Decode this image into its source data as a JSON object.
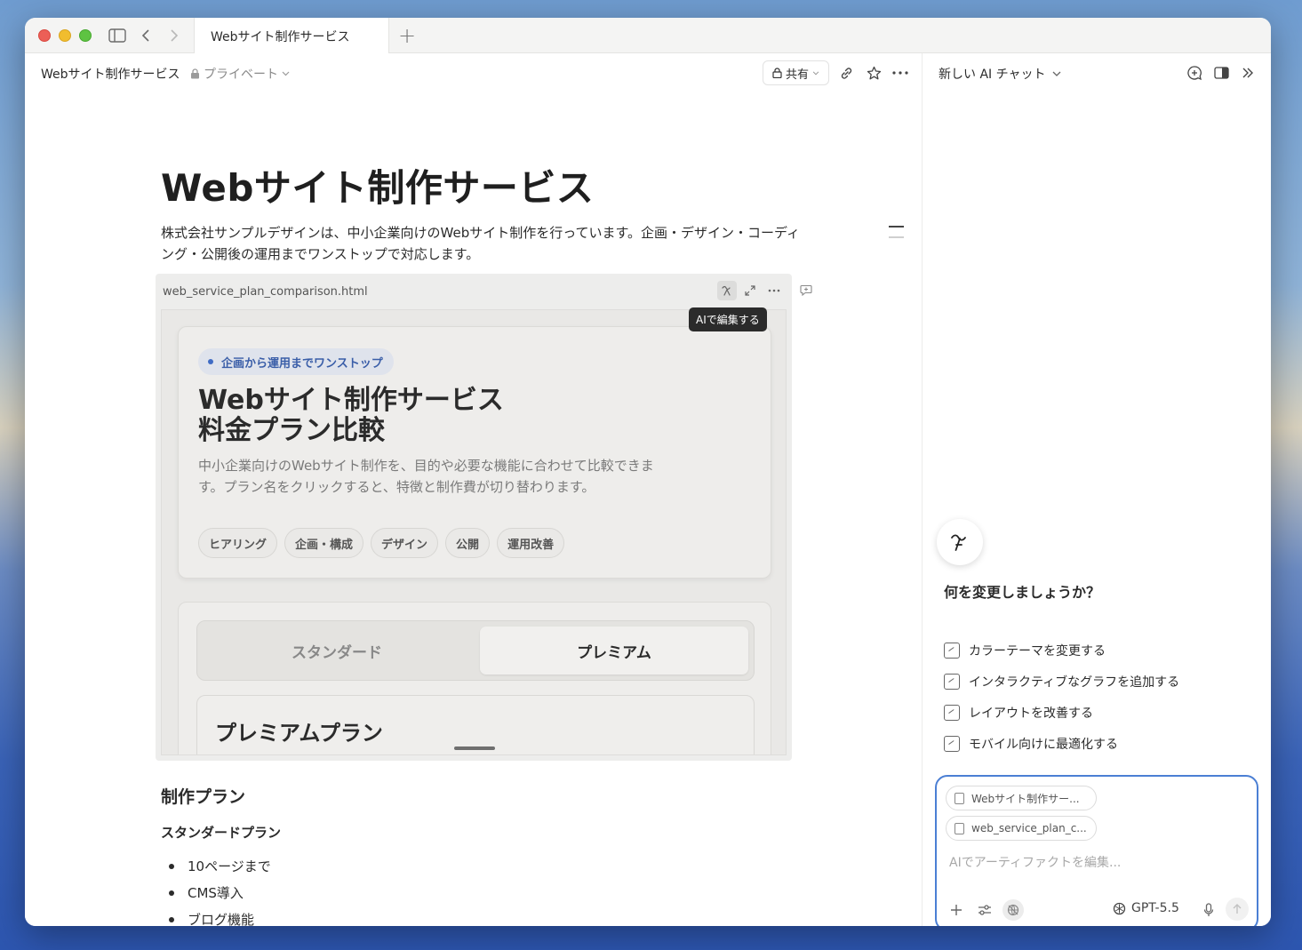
{
  "tab": {
    "title": "Webサイト制作サービス"
  },
  "doc_header": {
    "breadcrumb": "Webサイト制作サービス",
    "privacy": "プライベート",
    "share": "共有"
  },
  "document": {
    "title": "Webサイト制作サービス",
    "intro": "株式会社サンプルデザインは、中小企業向けのWebサイト制作を行っています。企画・デザイン・コーディング・公開後の運用までワンストップで対応します。",
    "artifact": {
      "filename": "web_service_plan_comparison.html",
      "tooltip": "AIで編集する",
      "preview": {
        "badge": "企画から運用までワンストップ",
        "title_line1": "Webサイト制作サービス",
        "title_line2": "料金プラン比較",
        "description": "中小企業向けのWebサイト制作を、目的や必要な機能に合わせて比較できます。プラン名をクリックすると、特徴と制作費が切り替わります。",
        "steps": [
          "ヒアリング",
          "企画・構成",
          "デザイン",
          "公開",
          "運用改善"
        ],
        "tabs": [
          "スタンダード",
          "プレミアム"
        ],
        "active_tab": "プレミアム",
        "plan_title": "プレミアムプラン"
      }
    },
    "section_heading": "制作プラン",
    "subheading": "スタンダードプラン",
    "bullets": [
      "10ページまで",
      "CMS導入",
      "ブログ機能"
    ]
  },
  "chat": {
    "title": "新しい AI チャット",
    "question": "何を変更しましょうか？",
    "suggestions": [
      "カラーテーマを変更する",
      "インタラクティブなグラフを追加する",
      "レイアウトを改善する",
      "モバイル向けに最適化する"
    ],
    "context_chips": [
      "Webサイト制作サー...",
      "web_service_plan_c..."
    ],
    "placeholder": "AIでアーティファクトを編集...",
    "model": "GPT-5.5"
  }
}
